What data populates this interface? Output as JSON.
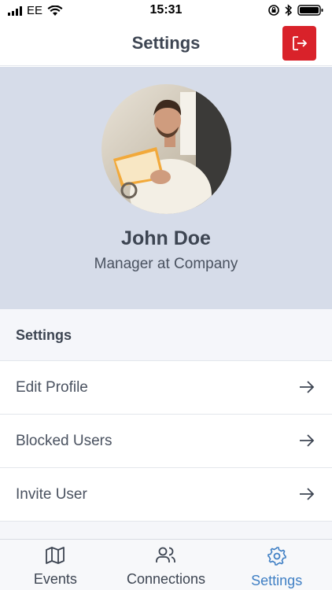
{
  "status_bar": {
    "carrier": "EE",
    "time": "15:31"
  },
  "nav": {
    "title": "Settings",
    "logout_icon": "logout-icon"
  },
  "profile": {
    "name": "John Doe",
    "role": "Manager at Company"
  },
  "settings_section": {
    "header": "Settings",
    "items": [
      {
        "label": "Edit Profile",
        "icon": "arrow-right-icon"
      },
      {
        "label": "Blocked Users",
        "icon": "arrow-right-icon"
      },
      {
        "label": "Invite User",
        "icon": "arrow-right-icon"
      }
    ]
  },
  "tabs": [
    {
      "label": "Events",
      "icon": "map-icon",
      "active": false
    },
    {
      "label": "Connections",
      "icon": "users-icon",
      "active": false
    },
    {
      "label": "Settings",
      "icon": "gear-icon",
      "active": true
    }
  ],
  "colors": {
    "accent": "#3f7fc4",
    "logout": "#d9222a",
    "profile_background": "#d6dce9"
  }
}
